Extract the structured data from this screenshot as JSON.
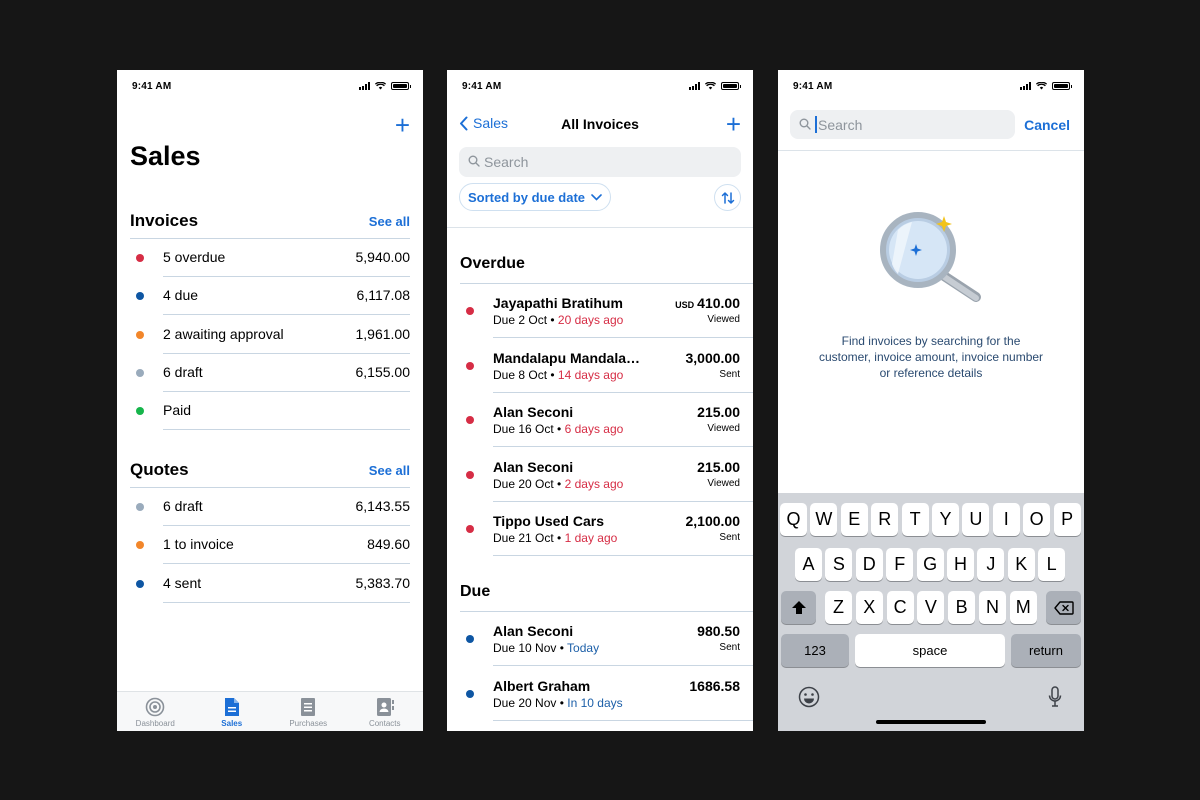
{
  "status": {
    "time": "9:41 AM"
  },
  "sales_screen": {
    "title": "Sales",
    "invoices": {
      "heading": "Invoices",
      "see_all": "See all",
      "rows": [
        {
          "label": "5 overdue",
          "value": "5,940.00",
          "color": "#d62d45"
        },
        {
          "label": "4 due",
          "value": "6,117.08",
          "color": "#0e56a3"
        },
        {
          "label": "2 awaiting approval",
          "value": "1,961.00",
          "color": "#f2862a"
        },
        {
          "label": "6 draft",
          "value": "6,155.00",
          "color": "#9aabbc"
        },
        {
          "label": "Paid",
          "value": "",
          "color": "#16b54b"
        }
      ]
    },
    "quotes": {
      "heading": "Quotes",
      "see_all": "See all",
      "rows": [
        {
          "label": "6 draft",
          "value": "6,143.55",
          "color": "#9aabbc"
        },
        {
          "label": "1 to invoice",
          "value": "849.60",
          "color": "#f2862a"
        },
        {
          "label": "4 sent",
          "value": "5,383.70",
          "color": "#0e56a3"
        }
      ]
    },
    "tabs": [
      {
        "label": "Dashboard",
        "icon": "dashboard-icon"
      },
      {
        "label": "Sales",
        "icon": "document-icon",
        "active": true
      },
      {
        "label": "Purchases",
        "icon": "receipt-icon"
      },
      {
        "label": "Contacts",
        "icon": "contacts-icon"
      }
    ]
  },
  "invoices_screen": {
    "back_label": "Sales",
    "title": "All Invoices",
    "search_placeholder": "Search",
    "sort_label": "Sorted by due date",
    "overdue_heading": "Overdue",
    "due_heading": "Due",
    "overdue": [
      {
        "name": "Jayapathi Bratihum",
        "due": "Due 2 Oct",
        "relative": "20 days ago",
        "currency": "USD",
        "amount": "410.00",
        "status": "Viewed"
      },
      {
        "name": "Mandalapu Mandalapu",
        "due": "Due 8 Oct",
        "relative": "14 days ago",
        "currency": "",
        "amount": "3,000.00",
        "status": "Sent"
      },
      {
        "name": "Alan Seconi",
        "due": "Due 16 Oct",
        "relative": "6 days ago",
        "currency": "",
        "amount": "215.00",
        "status": "Viewed"
      },
      {
        "name": "Alan Seconi",
        "due": "Due 20 Oct",
        "relative": "2 days ago",
        "currency": "",
        "amount": "215.00",
        "status": "Viewed"
      },
      {
        "name": "Tippo Used Cars",
        "due": "Due 21 Oct",
        "relative": "1 day ago",
        "currency": "",
        "amount": "2,100.00",
        "status": "Sent"
      }
    ],
    "due": [
      {
        "name": "Alan Seconi",
        "due": "Due 10 Nov",
        "relative": "Today",
        "currency": "",
        "amount": "980.50",
        "status": "Sent"
      },
      {
        "name": "Albert Graham",
        "due": "Due 20 Nov",
        "relative": "In 10 days",
        "currency": "",
        "amount": "1686.58",
        "status": ""
      }
    ],
    "separator": "•"
  },
  "search_screen": {
    "placeholder": "Search",
    "cancel": "Cancel",
    "help_text": "Find invoices by searching for the customer, invoice amount, invoice number or reference details",
    "keyboard": {
      "row1": [
        "Q",
        "W",
        "E",
        "R",
        "T",
        "Y",
        "U",
        "I",
        "O",
        "P"
      ],
      "row2": [
        "A",
        "S",
        "D",
        "F",
        "G",
        "H",
        "J",
        "K",
        "L"
      ],
      "row3": [
        "Z",
        "X",
        "C",
        "V",
        "B",
        "N",
        "M"
      ],
      "numbers": "123",
      "space": "space",
      "return": "return"
    }
  }
}
